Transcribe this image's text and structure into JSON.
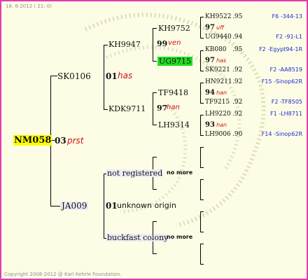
{
  "header": {
    "date_text": "18.  6-2012 ( 21: 0)"
  },
  "footer": {
    "copyright": "Copyright 2008-2012 @ Karl Kehrle Foundation."
  },
  "colors": {
    "frame": "#e23bb5",
    "background": "#fdfde5",
    "highlight_yellow": "#ffff00",
    "highlight_green": "#22dd22",
    "note_red": "#cc1111",
    "link_blue": "#1a2bd4"
  },
  "gen0": {
    "name": "NM058"
  },
  "gen1": {
    "sire": {
      "year": "03",
      "note": "prst"
    },
    "top": {
      "id": "SK0106",
      "year": "01",
      "note": "has"
    },
    "bottom": {
      "id": "JA009",
      "year": "01",
      "note": "unknown origin"
    }
  },
  "gen2": [
    {
      "id": "KH9947",
      "year": "99",
      "note": "ven"
    },
    {
      "id": "KDK9711",
      "year": "97",
      "note": "han"
    },
    {
      "id": "not registered",
      "note": "no more"
    },
    {
      "id": "buckfast colony",
      "note": "no more"
    }
  ],
  "gen3": [
    {
      "id": "KH9752",
      "year": "97",
      "note": "uff"
    },
    {
      "id": "UG9715",
      "year": "97",
      "note": "has"
    },
    {
      "id": "TF9418",
      "year": "94",
      "note": "han"
    },
    {
      "id": "LH9314",
      "year": "93",
      "note": "han"
    }
  ],
  "gen4": [
    {
      "id": "KH9522",
      "year": ".95",
      "ref": "F6 -344-13"
    },
    {
      "id": "UG9440",
      "year": ".94",
      "ref": "F2 -91-L1"
    },
    {
      "id": "KB080",
      "year": ".95",
      "ref": "F2 -Egypt94-1R"
    },
    {
      "id": "SK9221",
      "year": ".92",
      "ref": "F2 -AA8519"
    },
    {
      "id": "HN9211",
      "year": ".92",
      "ref": "F15 -Sinop62R"
    },
    {
      "id": "TF9215",
      "year": ".92",
      "ref": "F2 -TF8505"
    },
    {
      "id": "LH9220",
      "year": ".92",
      "ref": "F1 -LH8711"
    },
    {
      "id": "LH9006",
      "year": ".90",
      "ref": "F14 -Sinop62R"
    }
  ]
}
